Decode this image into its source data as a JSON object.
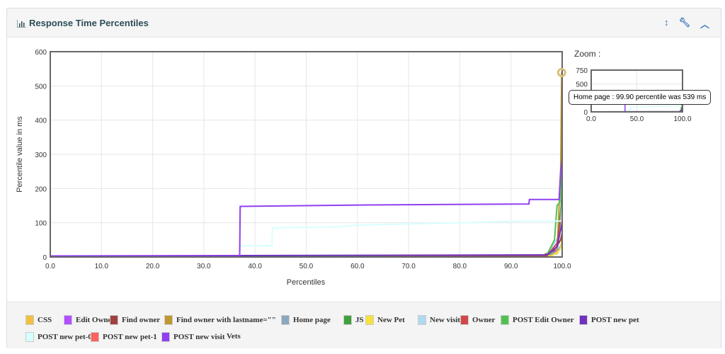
{
  "header": {
    "title": "Response Time Percentiles"
  },
  "tooltip": "Home page : 99.90 percentile was 539 ms",
  "zoom_label": "Zoom :",
  "chart_data": {
    "type": "line",
    "xlabel": "Percentiles",
    "ylabel": "Percentile value in ms",
    "xlim": [
      0,
      100
    ],
    "ylim": [
      0,
      600
    ],
    "xticks": [
      "0.0",
      "10.0",
      "20.0",
      "30.0",
      "40.0",
      "50.0",
      "60.0",
      "70.0",
      "80.0",
      "90.0",
      "100.0"
    ],
    "yticks": [
      "0",
      "100",
      "200",
      "300",
      "400",
      "500",
      "600"
    ],
    "zoom": {
      "xticks": [
        "0.0",
        "50.0",
        "100.0"
      ],
      "yticks": [
        "0",
        "250",
        "500",
        "750"
      ],
      "ylim": [
        0,
        750
      ]
    },
    "series": [
      {
        "name": "CSS",
        "color": "#f0c040",
        "points": [
          [
            0,
            1
          ],
          [
            97,
            2
          ],
          [
            99,
            10
          ],
          [
            99.8,
            30
          ],
          [
            100,
            60
          ]
        ]
      },
      {
        "name": "Edit Owner",
        "color": "#b050ff",
        "points": [
          [
            0,
            2
          ],
          [
            97,
            4
          ],
          [
            99,
            20
          ],
          [
            99.6,
            80
          ],
          [
            100,
            120
          ]
        ]
      },
      {
        "name": "Find owner",
        "color": "#a04040",
        "points": [
          [
            0,
            1
          ],
          [
            96,
            3
          ],
          [
            98.5,
            20
          ],
          [
            99.7,
            50
          ],
          [
            100,
            70
          ]
        ]
      },
      {
        "name": "Find owner with lastname=\"\"",
        "color": "#c09830",
        "points": [
          [
            0,
            1
          ],
          [
            96,
            3
          ],
          [
            99,
            15
          ],
          [
            99.7,
            250
          ],
          [
            99.9,
            539
          ],
          [
            100,
            539
          ]
        ]
      },
      {
        "name": "Home page",
        "color": "#8aa8c0",
        "points": [
          [
            0,
            1
          ],
          [
            97,
            3
          ],
          [
            99,
            15
          ],
          [
            100,
            40
          ]
        ]
      },
      {
        "name": "JS",
        "color": "#40a040",
        "points": [
          [
            0,
            1
          ],
          [
            97,
            3
          ],
          [
            99,
            30
          ],
          [
            99.8,
            150
          ],
          [
            100,
            200
          ]
        ]
      },
      {
        "name": "New Pet",
        "color": "#f8e040",
        "points": [
          [
            0,
            1
          ],
          [
            98,
            3
          ],
          [
            99.5,
            20
          ],
          [
            100,
            40
          ]
        ]
      },
      {
        "name": "New visit",
        "color": "#b0d8f0",
        "points": [
          [
            0,
            2
          ],
          [
            97,
            4
          ],
          [
            99.3,
            60
          ],
          [
            100,
            120
          ]
        ]
      },
      {
        "name": "Owner",
        "color": "#d04848",
        "points": [
          [
            0,
            1
          ],
          [
            97,
            3
          ],
          [
            99,
            40
          ],
          [
            99.8,
            120
          ],
          [
            100,
            150
          ]
        ]
      },
      {
        "name": "POST Edit Owner",
        "color": "#50c050",
        "points": [
          [
            0,
            2
          ],
          [
            97,
            6
          ],
          [
            98.5,
            50
          ],
          [
            99,
            150
          ],
          [
            99.5,
            160
          ],
          [
            100,
            250
          ]
        ]
      },
      {
        "name": "POST new pet",
        "color": "#7030c0",
        "points": [
          [
            0,
            3
          ],
          [
            97,
            6
          ],
          [
            99,
            30
          ],
          [
            100,
            100
          ]
        ]
      },
      {
        "name": "POST new pet-0",
        "color": "#d8ffff",
        "points": [
          [
            0,
            2
          ],
          [
            37,
            2
          ],
          [
            37.1,
            33
          ],
          [
            43.3,
            33
          ],
          [
            43.4,
            85
          ],
          [
            55,
            88
          ],
          [
            62,
            94
          ],
          [
            80,
            100
          ],
          [
            93,
            105
          ],
          [
            99.8,
            105
          ],
          [
            100,
            160
          ]
        ]
      },
      {
        "name": "POST new pet-1",
        "color": "#ff6060",
        "points": [
          [
            0,
            0
          ],
          [
            100,
            0
          ]
        ]
      },
      {
        "name": "POST new visit",
        "color": "#9040f0",
        "points": [
          [
            0,
            3
          ],
          [
            37,
            3
          ],
          [
            37.1,
            148
          ],
          [
            62,
            152
          ],
          [
            93.5,
            155
          ],
          [
            93.6,
            168
          ],
          [
            99.4,
            168
          ],
          [
            99.7,
            250
          ],
          [
            100,
            285
          ]
        ]
      },
      {
        "name": "Vets",
        "color": "",
        "points": []
      }
    ]
  }
}
